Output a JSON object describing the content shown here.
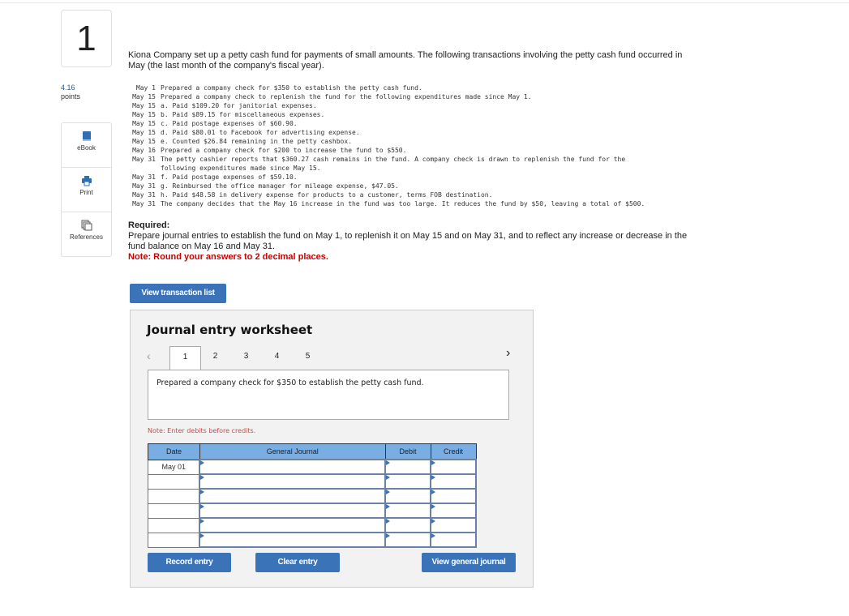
{
  "question": {
    "number": "1",
    "points_value": "4.16",
    "points_label": "points"
  },
  "sidebar": {
    "items": [
      {
        "label": "eBook",
        "icon": "book-icon"
      },
      {
        "label": "Print",
        "icon": "printer-icon"
      },
      {
        "label": "References",
        "icon": "copy-icon"
      }
    ]
  },
  "intro": "Kiona Company set up a petty cash fund for payments of small amounts. The following transactions involving the petty cash fund occurred in May (the last month of the company's fiscal year).",
  "transactions": [
    {
      "date": "May 1",
      "text": "Prepared a company check for $350 to establish the petty cash fund."
    },
    {
      "date": "May 15",
      "text": "Prepared a company check to replenish the fund for the following expenditures made since May 1."
    },
    {
      "date": "May 15",
      "text": "a. Paid $109.20 for janitorial expenses."
    },
    {
      "date": "May 15",
      "text": "b. Paid $89.15 for miscellaneous expenses."
    },
    {
      "date": "May 15",
      "text": "c. Paid postage expenses of $60.90."
    },
    {
      "date": "May 15",
      "text": "d. Paid $80.01 to Facebook for advertising expense."
    },
    {
      "date": "May 15",
      "text": "e. Counted $26.84 remaining in the petty cashbox."
    },
    {
      "date": "May 16",
      "text": "Prepared a company check for $200 to increase the fund to $550."
    },
    {
      "date": "May 31",
      "text": "The petty cashier reports that $360.27 cash remains in the fund. A company check is drawn to replenish the fund for the"
    },
    {
      "date": "",
      "text": "following expenditures made since May 15."
    },
    {
      "date": "May 31",
      "text": "f. Paid postage expenses of $59.10."
    },
    {
      "date": "May 31",
      "text": "g. Reimbursed the office manager for mileage expense, $47.05."
    },
    {
      "date": "May 31",
      "text": "h. Paid $48.58 in delivery expense for products to a customer, terms FOB destination."
    },
    {
      "date": "May 31",
      "text": "The company decides that the May 16 increase in the fund was too large. It reduces the fund by $50, leaving a total of $500."
    }
  ],
  "required": {
    "heading": "Required:",
    "text": "Prepare journal entries to establish the fund on May 1, to replenish it on May 15 and on May 31, and to reflect any increase or decrease in the fund balance on May 16 and May 31.",
    "note": "Note: Round your answers to 2 decimal places."
  },
  "view_transaction_list": "View transaction list",
  "worksheet": {
    "title": "Journal entry worksheet",
    "tabs": [
      "1",
      "2",
      "3",
      "4",
      "5"
    ],
    "active_tab": "1",
    "description": "Prepared a company check for $350 to establish the petty cash fund.",
    "note": "Note: Enter debits before credits.",
    "columns": [
      "Date",
      "General Journal",
      "Debit",
      "Credit"
    ],
    "rows": [
      {
        "date": "May 01"
      },
      {
        "date": ""
      },
      {
        "date": ""
      },
      {
        "date": ""
      },
      {
        "date": ""
      },
      {
        "date": ""
      }
    ],
    "record_entry": "Record entry",
    "clear_entry": "Clear entry",
    "view_general_journal": "View general journal"
  },
  "colors": {
    "accent": "#3a73b8",
    "header": "#7aaee3",
    "note_red": "#c00000"
  }
}
